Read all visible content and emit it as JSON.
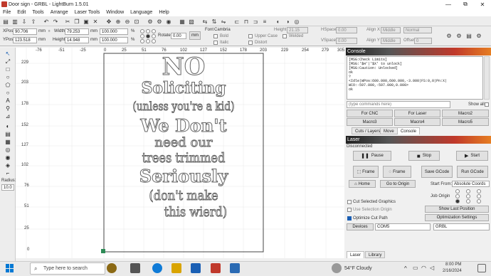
{
  "window": {
    "title": "Door sign - GRBL - LightBurn 1.5.01",
    "minimize": "—",
    "maximize": "⧉",
    "close": "✕"
  },
  "menu": [
    "File",
    "Edit",
    "Tools",
    "Arrange",
    "Laser Tools",
    "Window",
    "Language",
    "Help"
  ],
  "position": {
    "xpos_label": "XPos",
    "xpos": "90.706",
    "ypos_label": "YPos",
    "ypos": "123.518",
    "unit": "mm",
    "width_label": "Width",
    "width": "79.253",
    "height_label": "Height",
    "height": "14.948",
    "scale_w": "100.000",
    "scale_h": "100.000",
    "pct": "%",
    "rotate_label": "Rotate",
    "rotate": "0.00",
    "mm_button": "mm"
  },
  "text_tools": {
    "font_label": "Font",
    "font": "Cambria",
    "height_label": "Height",
    "height": "21.15",
    "hspace_label": "HSpace",
    "hspace": "0.00",
    "vspace_label": "VSpace",
    "vspace": "0.00",
    "bold": "Bold",
    "italic": "Italic",
    "upper_case": "Upper Case",
    "distort": "Distort",
    "welded": "Welded",
    "alignx_label": "Align X",
    "alignx": "Middle",
    "aligny_label": "Align Y",
    "aligny": "Middle",
    "normal": "Normal",
    "offset_label": "Offset",
    "offset": "0"
  },
  "ruler": {
    "top": [
      "-76",
      "-51",
      "-25",
      "0",
      "25",
      "51",
      "76",
      "102",
      "127",
      "152",
      "178",
      "203",
      "229",
      "254",
      "279",
      "305"
    ],
    "left": [
      "229",
      "203",
      "178",
      "152",
      "127",
      "102",
      "76",
      "51",
      "25",
      "0"
    ]
  },
  "left_tools": {
    "radius_label": "Radius:",
    "radius": "10.0"
  },
  "design_text": [
    "NO",
    "Soliciting",
    "(unless you're a kid)",
    "We Don't",
    "need our",
    "trees trimmed",
    "Seriously",
    "(don't make",
    "this wierd)"
  ],
  "console": {
    "header": "Console",
    "lines": [
      "[MSG:Check Limits]",
      "[MSG:'$H'|'$X' to unlock]",
      "[MSG:Caution: Unlocked]",
      "ok",
      "?",
      "<Idle|WPos:600.000,600.000,-3.000|FS:0,0|Pn:X|",
      "WCO:-597.000,-597.000,0.000>",
      "ok"
    ],
    "placeholder": "(type commands here)",
    "show_all": "Show all",
    "macros": [
      "For CNC",
      "For Laser",
      "Macro2",
      "Macro3",
      "Macro4",
      "Macro5"
    ]
  },
  "tabs_mid": [
    "Cuts / Layers",
    "Move",
    "Console"
  ],
  "laser": {
    "header": "Laser",
    "status": "Disconnected",
    "pause": "Pause",
    "stop": "Stop",
    "start": "Start",
    "frame1": "Frame",
    "frame2": "Frame",
    "save_gcode": "Save GCode",
    "run_gcode": "Run GCode",
    "home": "Home",
    "go_to_origin": "Go to Origin",
    "start_from_label": "Start From:",
    "start_from": "Absolute Coords",
    "job_origin": "Job Origin",
    "cut_selected": "Cut Selected Graphics",
    "use_selection_origin": "Use Selection Origin",
    "optimize_cut_path": "Optimize Cut Path",
    "show_last_position": "Show Last Position",
    "optimization_settings": "Optimization Settings",
    "devices": "Devices",
    "port": "COM5",
    "device": "GRBL"
  },
  "tabs_bottom": [
    "Laser",
    "Library"
  ],
  "taskbar": {
    "search": "Type here to search",
    "weather": "54°F  Cloudy",
    "time": "8:00 PM",
    "date": "2/16/2024"
  },
  "colors": {
    "accent": "#c0392b",
    "canvas_border": "#444444",
    "grid": "#e8e8e8"
  }
}
